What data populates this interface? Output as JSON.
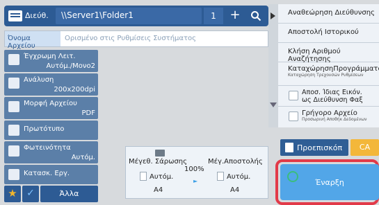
{
  "topbar": {
    "label": "Διεύθ.",
    "address": "\\\\Server1\\Folder1",
    "count": "1",
    "add": "+",
    "search": "search-icon"
  },
  "file_name": {
    "label": "Όνομα Αρχείου",
    "placeholder": "Ορισμένο στις Ρυθμίσεις Συστήματος"
  },
  "left_settings": [
    {
      "title": "Έγχρωμη Λειτ.",
      "value": "Αυτόμ./Μονο2"
    },
    {
      "title": "Ανάλυση",
      "value": "200x200dpi"
    },
    {
      "title": "Μορφή Αρχείου",
      "value": "PDF"
    },
    {
      "title": "Πρωτότυπο",
      "value": ""
    },
    {
      "title": "Φωτεινότητα",
      "value": "Αυτόμ."
    },
    {
      "title": "Κατασκ. Εργ.",
      "value": ""
    }
  ],
  "bottom_tabs": {
    "more": "Άλλα"
  },
  "preview": {
    "scan_size_label": "Μέγεθ. Σάρωσης",
    "scan_size_mode": "Αυτόμ.",
    "scan_size_value": "A4",
    "ratio": "100%",
    "send_size_label": "Μέγ.Αποστολής",
    "send_size_mode": "Αυτόμ.",
    "send_size_value": "A4"
  },
  "right_menu": {
    "item1": "Αναθεώρηση Διεύθυνσης",
    "item2": "Αποστολή Ιστορικού",
    "item3": "Κλήση Αριθμού Αναζήτησης",
    "item4_title": "ΚαταχώρησηΠρογράμματος",
    "item4_sub": "Καταχώρηση Τρεχουσών Ρυθμίσεων",
    "item5_line1": "Αποσ. Ίδιας Εικόν.",
    "item5_line2": "ως Διεύθυνση Φαξ",
    "item6_title": "Γρήγορο Αρχείο",
    "item6_sub": "Προσωρινή Αποθήκ Δεδομένων"
  },
  "actions": {
    "preview": "Προεπισκόπ",
    "ca": "CA",
    "start": "Έναρξη"
  }
}
